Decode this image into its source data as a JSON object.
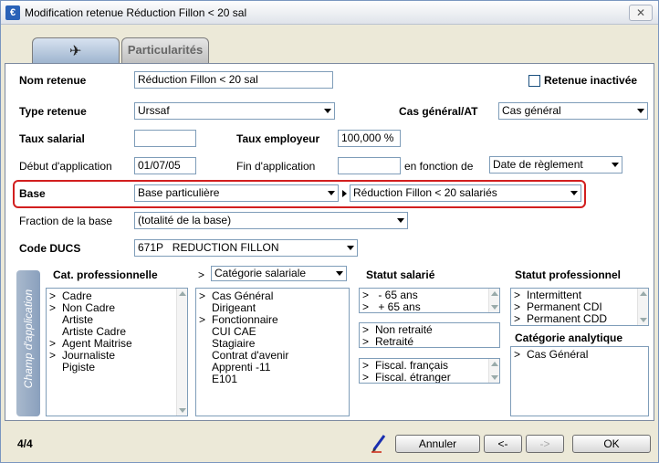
{
  "window": {
    "title": "Modification retenue Réduction Fillon < 20 sal",
    "close_label": "✕"
  },
  "tabs": [
    {
      "label": ""
    },
    {
      "label": "Particularités"
    }
  ],
  "form": {
    "nom_label": "Nom retenue",
    "nom_value": "Réduction Fillon < 20 sal",
    "inactive_label": "Retenue inactivée",
    "type_label": "Type retenue",
    "type_value": "Urssaf",
    "cas_label": "Cas général/AT",
    "cas_value": "Cas général",
    "taux_sal_label": "Taux salarial",
    "taux_sal_value": "",
    "taux_emp_label": "Taux employeur",
    "taux_emp_value": "100,000 %",
    "debut_label": "Début d'application",
    "debut_value": "01/07/05",
    "fin_label": "Fin d'application",
    "fin_value": "",
    "fonction_label": "en fonction de",
    "fonction_value": "Date de règlement",
    "base_label": "Base",
    "base_value": "Base particulière",
    "base_detail_value": "Réduction Fillon < 20 salariés",
    "fraction_label": "Fraction de la base",
    "fraction_value": "(totalité de la base)",
    "ducs_label": "Code DUCS",
    "ducs_value": "671P   REDUCTION FILLON"
  },
  "champ": {
    "label": "Champ d'application",
    "cat_pro_label": "Cat. professionnelle",
    "cat_pro_items": [
      {
        "mark": ">",
        "text": "Cadre"
      },
      {
        "mark": ">",
        "text": "Non Cadre"
      },
      {
        "mark": "",
        "text": "Artiste"
      },
      {
        "mark": "",
        "text": "Artiste Cadre"
      },
      {
        "mark": ">",
        "text": "Agent Maitrise"
      },
      {
        "mark": ">",
        "text": "Journaliste"
      },
      {
        "mark": "",
        "text": "Pigiste"
      }
    ],
    "cat_sal_prefix": ">",
    "cat_sal_select": "Catégorie salariale",
    "cat_sal_items": [
      {
        "mark": ">",
        "text": "Cas Général"
      },
      {
        "mark": "",
        "text": "Dirigeant"
      },
      {
        "mark": ">",
        "text": "Fonctionnaire"
      },
      {
        "mark": "",
        "text": "CUI CAE"
      },
      {
        "mark": "",
        "text": "Stagiaire"
      },
      {
        "mark": "",
        "text": "Contrat d'avenir"
      },
      {
        "mark": "",
        "text": "Apprenti -11"
      },
      {
        "mark": "",
        "text": "E101"
      }
    ],
    "statut_sal_label": "Statut salarié",
    "age_items": [
      {
        "mark": ">",
        "text": " - 65 ans"
      },
      {
        "mark": ">",
        "text": " + 65 ans"
      }
    ],
    "retraite_items": [
      {
        "mark": ">",
        "text": "Non retraité"
      },
      {
        "mark": ">",
        "text": "Retraité"
      }
    ],
    "fiscal_items": [
      {
        "mark": ">",
        "text": "Fiscal. français"
      },
      {
        "mark": ">",
        "text": "Fiscal. étranger"
      }
    ],
    "statut_pro_label": "Statut professionnel",
    "statut_pro_items": [
      {
        "mark": ">",
        "text": "Intermittent"
      },
      {
        "mark": ">",
        "text": "Permanent CDI"
      },
      {
        "mark": ">",
        "text": "Permanent CDD"
      }
    ],
    "cat_ana_label": "Catégorie analytique",
    "cat_ana_items": [
      {
        "mark": ">",
        "text": "Cas Général"
      }
    ]
  },
  "footer": {
    "counter": "4/4",
    "annuler_label": "Annuler",
    "prev_label": "<-",
    "next_label": "->",
    "ok_label": "OK"
  },
  "colors": {
    "highlight_border": "#d21f1f",
    "tab_active": "#9fb5cf"
  },
  "icons": {
    "app": "app-icon",
    "tab1": "airplane-icon",
    "pencil": "pencil-icon"
  }
}
